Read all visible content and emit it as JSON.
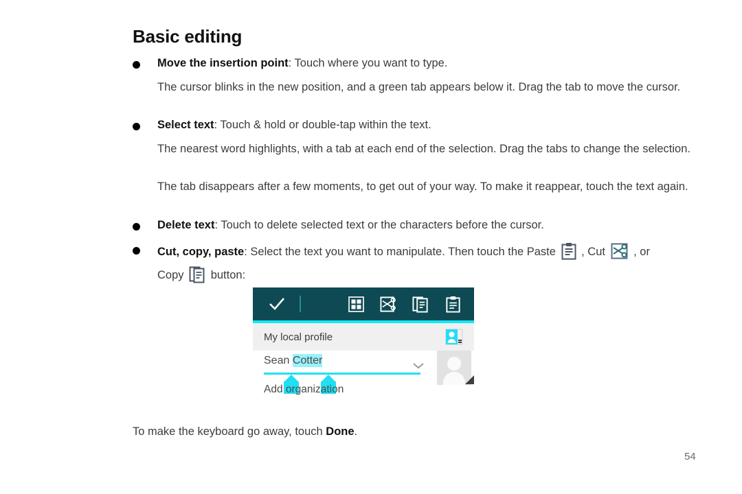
{
  "page": {
    "heading": "Basic editing",
    "page_number": "54",
    "footer_text_before": "To make the keyboard go away, touch ",
    "footer_text_bold": "Done",
    "footer_text_after": "."
  },
  "bullets": [
    {
      "label": "Move the insertion point",
      "rest": ": Touch where you want to type.",
      "paragraphs": [
        "The cursor blinks in the new position, and a green tab appears below it. Drag the tab to move the cursor."
      ]
    },
    {
      "label": "Select text",
      "rest": ": Touch & hold or double-tap within the text.",
      "paragraphs": [
        "The nearest word highlights, with a tab at each end of the selection. Drag the tabs to change the selection.",
        "The tab disappears after a few moments, to get out of your way. To make it reappear, touch the text again."
      ]
    },
    {
      "label": "Delete text",
      "rest": ": Touch  to delete selected text or the characters before the cursor.",
      "paragraphs": []
    },
    {
      "label": "Cut, copy, paste",
      "rest_1": ": Select the text you want to manipulate. Then touch the Paste ",
      "rest_2": " , Cut ",
      "rest_3": " , or",
      "rest_4": "Copy ",
      "rest_5": " button:",
      "paragraphs": []
    }
  ],
  "mockup": {
    "toolbar": {
      "confirm_icon": "check-icon",
      "icons": [
        {
          "name": "select-all-icon",
          "label": "Select all"
        },
        {
          "name": "cut-icon",
          "label": "Cut"
        },
        {
          "name": "copy-icon",
          "label": "Copy"
        },
        {
          "name": "paste-icon",
          "label": "Paste"
        }
      ]
    },
    "profile_row": {
      "label": "My local profile",
      "icon": "contact-card-icon"
    },
    "name_field": {
      "text_unselected": "Sean ",
      "text_selected": "Cotter"
    },
    "add_organization": "Add organization",
    "chevron_icon": "chevron-down-icon",
    "avatar_icon": "avatar-placeholder-icon"
  },
  "colors": {
    "toolbar_bg": "#0d4a54",
    "accent_cyan": "#12e7f5",
    "selection_cyan": "#9bf0fb",
    "handle_cyan": "#21dff2",
    "profile_row_bg": "#f0f0f0",
    "text": "#3c3c3c"
  }
}
